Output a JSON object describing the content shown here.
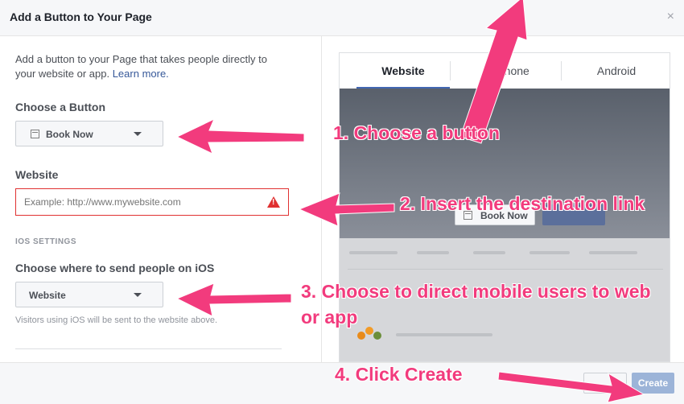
{
  "dialog": {
    "title": "Add a Button to Your Page",
    "close_glyph": "×"
  },
  "left": {
    "intro_text": "Add a button to your Page that takes people directly to your website or app.",
    "learn_more": "Learn more.",
    "choose_button_label": "Choose a Button",
    "button_select_value": "Book Now",
    "website_label": "Website",
    "website_placeholder": "Example: http://www.mywebsite.com",
    "warning_glyph": "!",
    "ios_section": "IOS SETTINGS",
    "ios_label": "Choose where to send people on iOS",
    "ios_select_value": "Website",
    "ios_hint": "Visitors using iOS will be sent to the website above."
  },
  "preview": {
    "tabs": [
      {
        "label": "Website",
        "active": true
      },
      {
        "label": "iPhone",
        "active": false
      },
      {
        "label": "Android",
        "active": false
      }
    ],
    "book_now": "Book Now"
  },
  "footer": {
    "create_label": "Create"
  },
  "annotations": {
    "step1": "1. Choose a button",
    "step2": "2. Insert the destination link",
    "step3_line1": "3. Choose to direct mobile users to web",
    "step3_line2": "or app",
    "step4": "4. Click Create"
  },
  "colors": {
    "annotation": "#f23b7d",
    "error": "#e03131",
    "link": "#365899",
    "create_button": "#9cb4d8"
  }
}
